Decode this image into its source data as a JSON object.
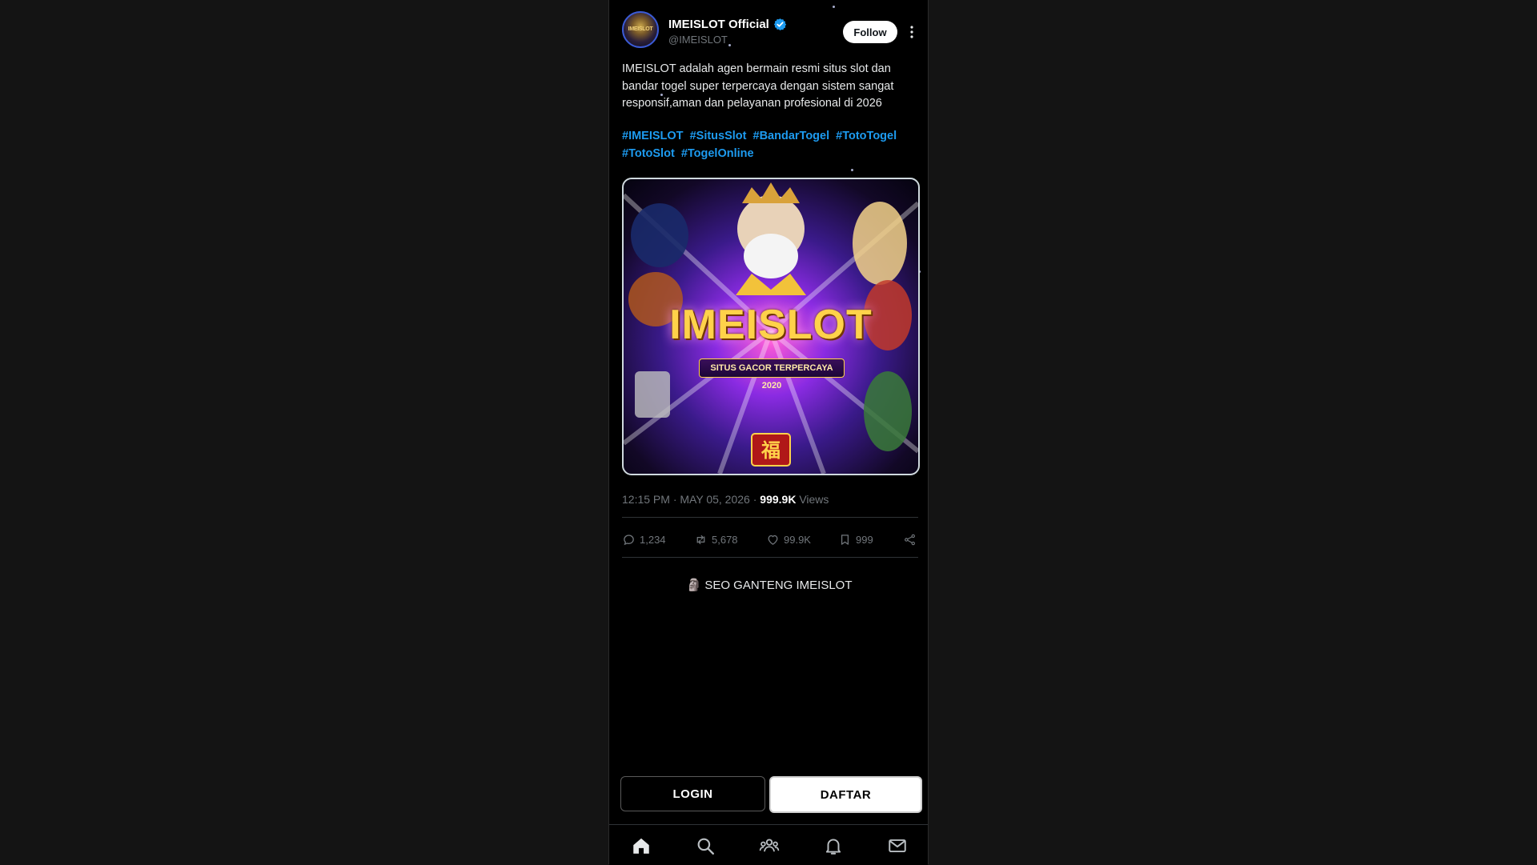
{
  "tweet": {
    "display_name": "IMEISLOT Official",
    "handle": "@IMEISLOT",
    "avatar_text": "IMEISLOT",
    "follow_label": "Follow",
    "more_icon": "more-vertical-icon",
    "verified_icon": "verified-badge-icon",
    "body": "IMEISLOT adalah agen bermain resmi situs slot dan bandar togel super terpercaya dengan sistem sangat responsif,aman dan pelayanan profesional di 2026",
    "hashtags": [
      "#IMEISLOT",
      "#SitusSlot",
      "#BandarTogel",
      "#TotoTogel",
      "#TotoSlot",
      "#TogelOnline"
    ],
    "media": {
      "title": "IMEISLOT",
      "subtitle": "SITUS GACOR TERPERCAYA 2020",
      "seal": "福"
    },
    "time": "12:15 PM",
    "date": "MAY 05, 2026",
    "views_count": "999.9K",
    "views_label": "Views",
    "actions": {
      "replies": "1,234",
      "retweets": "5,678",
      "likes": "99.9K",
      "bookmarks": "999"
    }
  },
  "promo_text": "🗿 SEO GANTENG IMEISLOT",
  "buttons": {
    "login": "LOGIN",
    "daftar": "DAFTAR"
  },
  "nav": [
    "home-icon",
    "search-icon",
    "communities-icon",
    "notifications-icon",
    "messages-icon"
  ],
  "colors": {
    "background": "#000000",
    "accent": "#1d9bf0",
    "muted": "#71767b",
    "text": "#e7e9ea"
  }
}
